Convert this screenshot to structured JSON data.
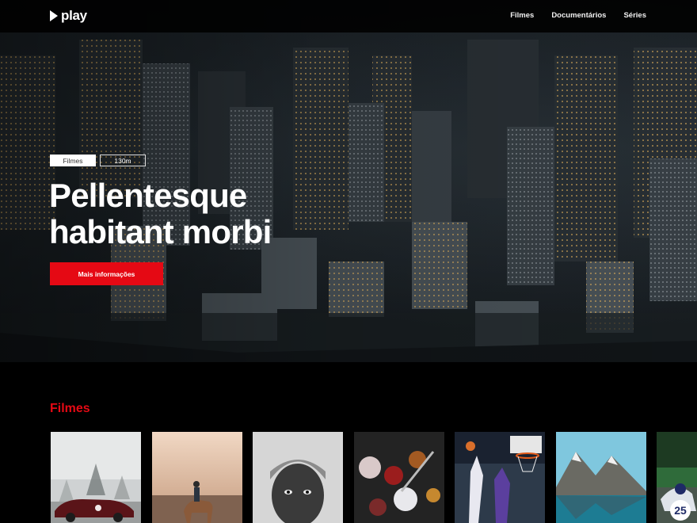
{
  "app": {
    "name": "play"
  },
  "nav": {
    "logo_icon": "play-icon",
    "links": [
      "Filmes",
      "Documentários",
      "Séries"
    ]
  },
  "hero": {
    "category_tag": "Filmes",
    "duration_tag": "130m",
    "title_line1": "Pellentesque",
    "title_line2": "habitant morbi",
    "cta_label": "Mais informações",
    "accent_color": "#e50914"
  },
  "catalog": {
    "section_title": "Filmes",
    "cards": [
      {
        "label": "car-in-fog-thumbnail"
      },
      {
        "label": "horse-rider-sunset-thumbnail"
      },
      {
        "label": "child-portrait-thumbnail"
      },
      {
        "label": "spices-thumbnail"
      },
      {
        "label": "basketball-thumbnail"
      },
      {
        "label": "mountain-lake-thumbnail"
      },
      {
        "label": "motorcycle-race-thumbnail"
      }
    ]
  }
}
